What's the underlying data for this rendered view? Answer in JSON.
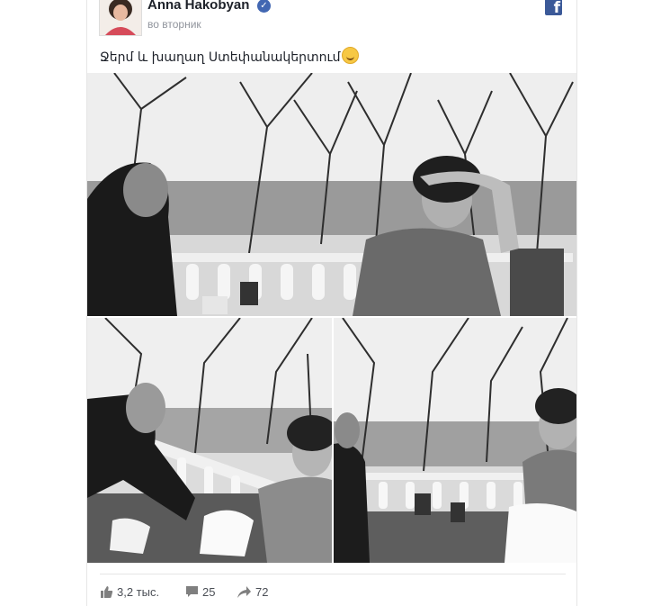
{
  "post": {
    "author": "Anna Hakobyan",
    "timestamp": "во вторник",
    "text": "Ջերմ և խաղաղ Ստեփանակերտում",
    "emoji": "smiling-face-emoji"
  },
  "icons": {
    "brand": "facebook-logo-icon",
    "verified": "verified-badge-icon"
  },
  "colors": {
    "facebook_blue": "#3b5998",
    "verified_blue": "#4267b2",
    "secondary_text": "#90949c"
  },
  "photos": [
    {
      "name": "photo-1"
    },
    {
      "name": "photo-2"
    },
    {
      "name": "photo-3"
    }
  ],
  "actions": {
    "likes": "3,2 тыс.",
    "comments": "25",
    "shares": "72"
  }
}
